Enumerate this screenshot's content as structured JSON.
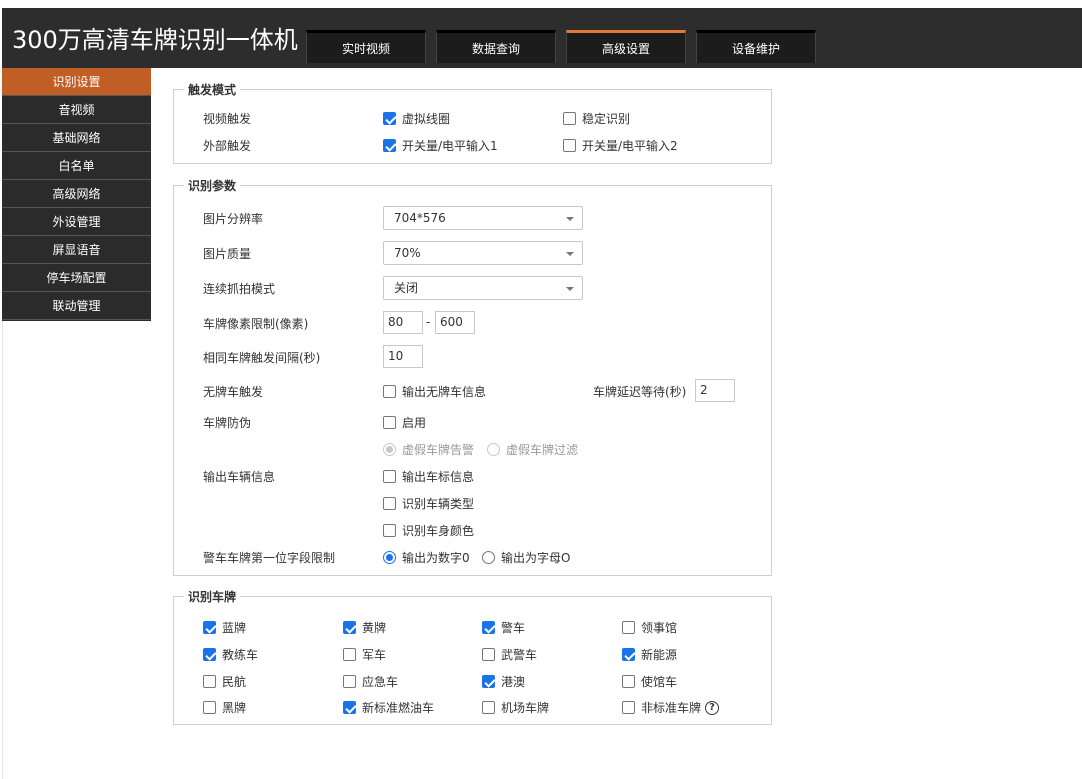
{
  "app": {
    "title": "300万高清车牌识别一体机"
  },
  "nav": {
    "tabs": [
      {
        "label": "实时视频"
      },
      {
        "label": "数据查询"
      },
      {
        "label": "高级设置"
      },
      {
        "label": "设备维护"
      }
    ]
  },
  "sidebar": {
    "items": [
      {
        "label": "识别设置"
      },
      {
        "label": "音视频"
      },
      {
        "label": "基础网络"
      },
      {
        "label": "白名单"
      },
      {
        "label": "高级网络"
      },
      {
        "label": "外设管理"
      },
      {
        "label": "屏显语音"
      },
      {
        "label": "停车场配置"
      },
      {
        "label": "联动管理"
      }
    ]
  },
  "trigger": {
    "title": "触发模式",
    "video_label": "视频触发",
    "virtual_coil": "虚拟线圈",
    "stable_recog": "稳定识别",
    "external_label": "外部触发",
    "io_input1": "开关量/电平输入1",
    "io_input2": "开关量/电平输入2"
  },
  "params": {
    "title": "识别参数",
    "resolution_label": "图片分辨率",
    "resolution_value": "704*576",
    "quality_label": "图片质量",
    "quality_value": "70%",
    "burst_label": "连续抓拍模式",
    "burst_value": "关闭",
    "pixel_label": "车牌像素限制(像素)",
    "pixel_min": "80",
    "pixel_sep": "-",
    "pixel_max": "600",
    "interval_label": "相同车牌触发间隔(秒)",
    "interval_value": "10",
    "noplate_label": "无牌车触发",
    "noplate_output": "输出无牌车信息",
    "delay_label": "车牌延迟等待(秒)",
    "delay_value": "2",
    "antifake_label": "车牌防伪",
    "antifake_enable": "启用",
    "fake_alarm": "虚假车牌告警",
    "fake_filter": "虚假车牌过滤",
    "vehicle_label": "输出车辆信息",
    "vehicle_logo": "输出车标信息",
    "vehicle_type": "识别车辆类型",
    "vehicle_color": "识别车身颜色",
    "police_label": "警车车牌第一位字段限制",
    "police_digit": "输出为数字0",
    "police_letter": "输出为字母O"
  },
  "plates": {
    "title": "识别车牌",
    "items": [
      {
        "label": "蓝牌"
      },
      {
        "label": "黄牌"
      },
      {
        "label": "警车"
      },
      {
        "label": "领事馆"
      },
      {
        "label": "教练车"
      },
      {
        "label": "军车"
      },
      {
        "label": "武警车"
      },
      {
        "label": "新能源"
      },
      {
        "label": "民航"
      },
      {
        "label": "应急车"
      },
      {
        "label": "港澳"
      },
      {
        "label": "使馆车"
      },
      {
        "label": "黑牌"
      },
      {
        "label": "新标准燃油车"
      },
      {
        "label": "机场车牌"
      },
      {
        "label": "非标准车牌"
      }
    ],
    "help_glyph": "?"
  },
  "colors": {
    "accent": "#c15e25",
    "header_bg": "#2d2d2d",
    "sidebar_bg": "#2b2b2b",
    "check": "#1a73e8"
  }
}
